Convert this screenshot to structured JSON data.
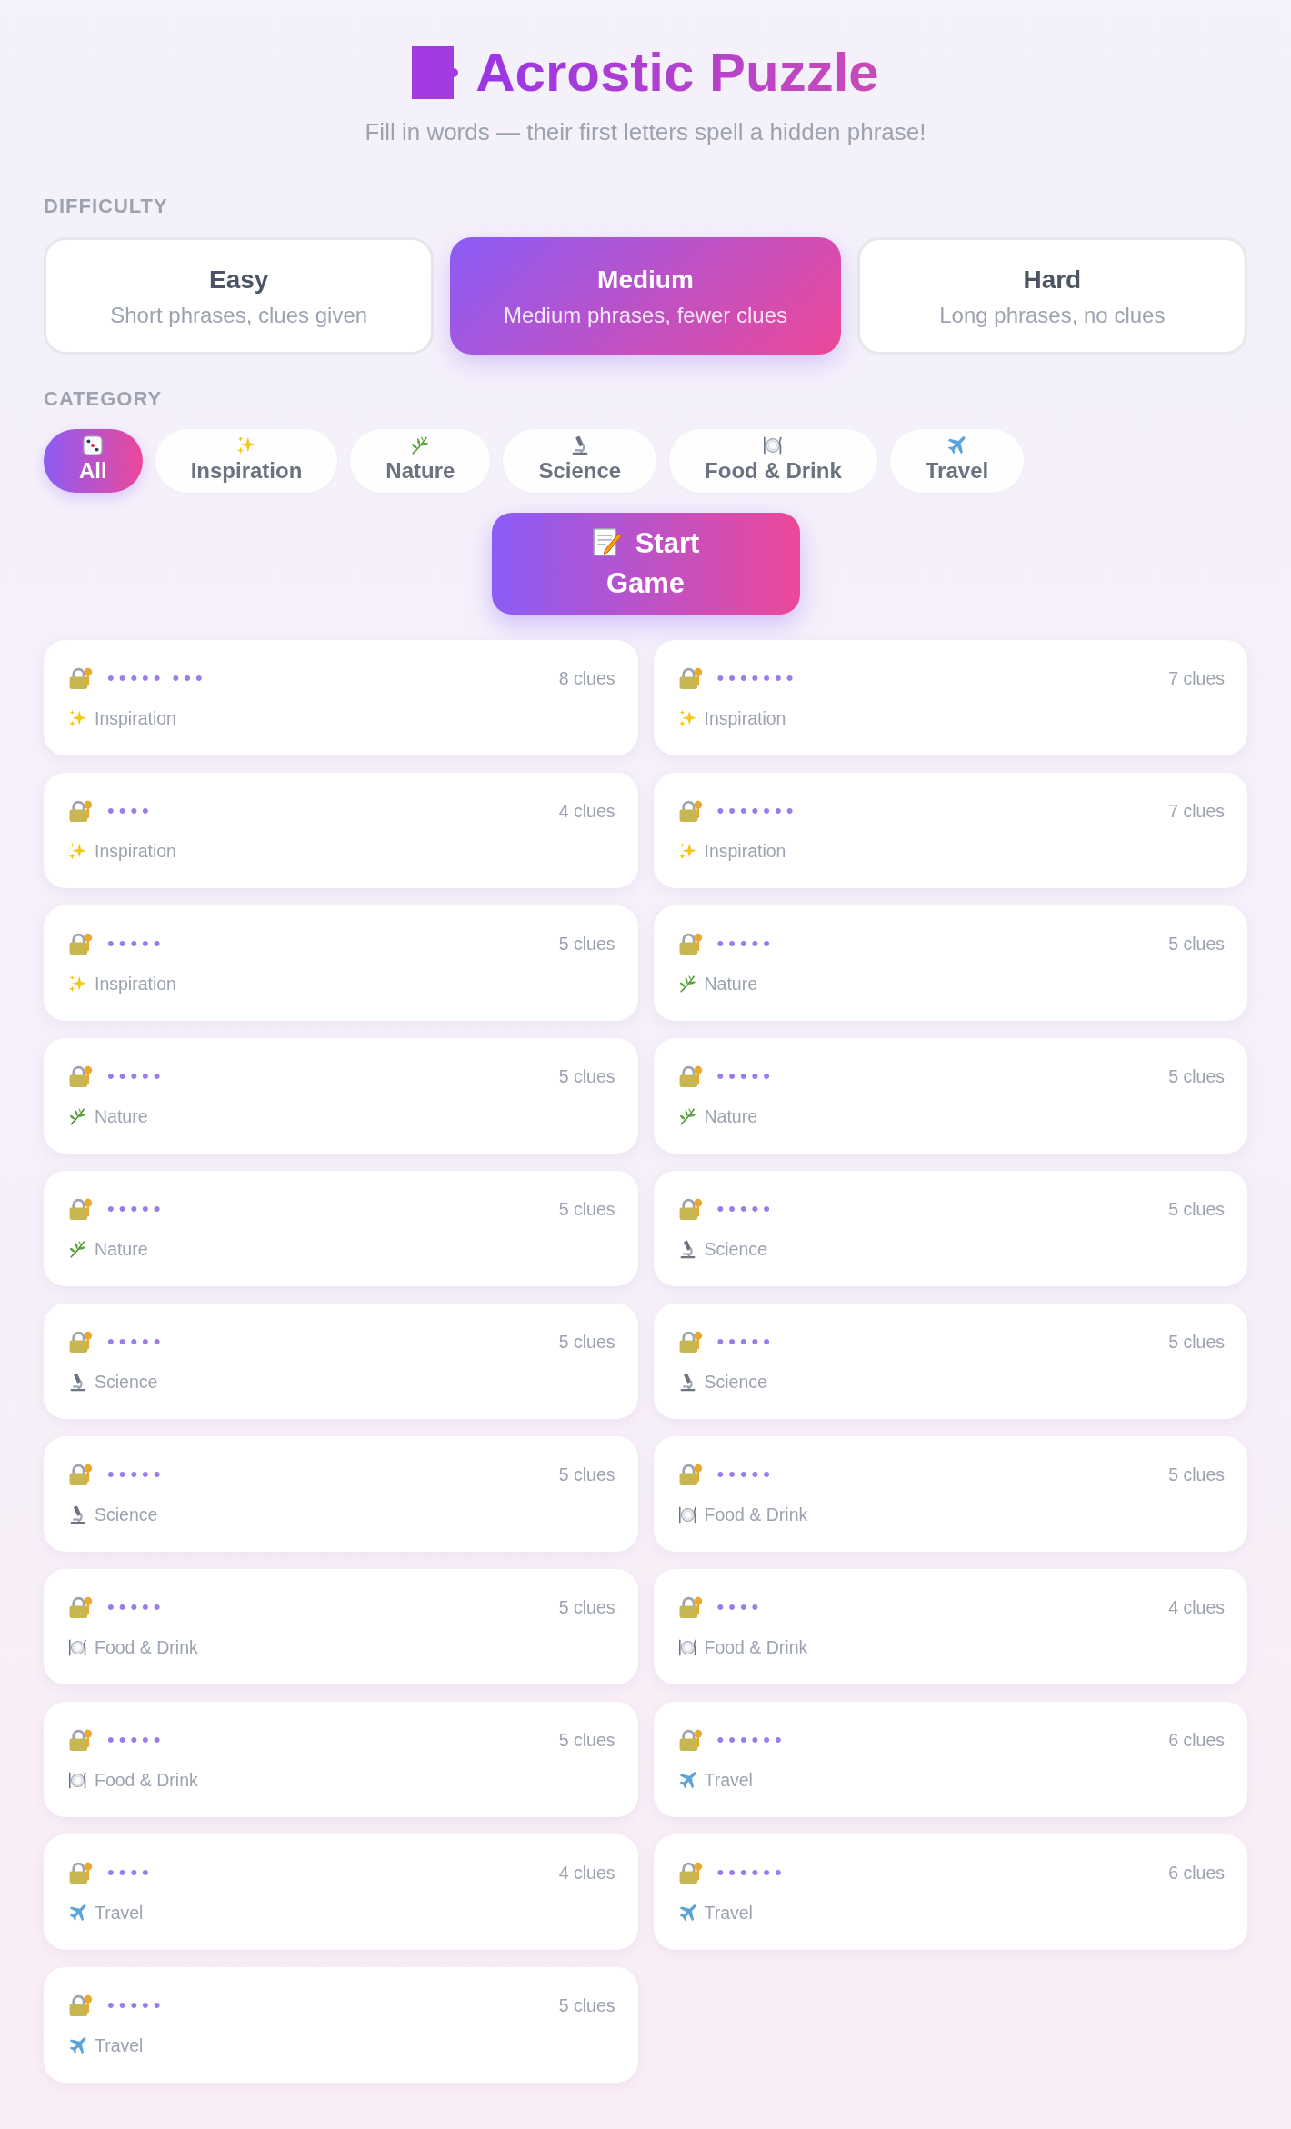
{
  "header": {
    "title": "Acrostic Puzzle",
    "subtitle": "Fill in words — their first letters spell a hidden phrase!"
  },
  "difficulty": {
    "label": "DIFFICULTY",
    "options": [
      {
        "label": "Easy",
        "description": "Short phrases, clues given",
        "selected": false
      },
      {
        "label": "Medium",
        "description": "Medium phrases, fewer clues",
        "selected": true
      },
      {
        "label": "Hard",
        "description": "Long phrases, no clues",
        "selected": false
      }
    ]
  },
  "category": {
    "label": "CATEGORY",
    "options": [
      {
        "label": "All",
        "kind": "dice",
        "selected": true
      },
      {
        "label": "Inspiration",
        "kind": "sparkles",
        "selected": false
      },
      {
        "label": "Nature",
        "kind": "leaf",
        "selected": false
      },
      {
        "label": "Science",
        "kind": "microscope",
        "selected": false
      },
      {
        "label": "Food & Drink",
        "kind": "plate",
        "selected": false
      },
      {
        "label": "Travel",
        "kind": "plane",
        "selected": false
      }
    ]
  },
  "start_button": {
    "label": "Start Game"
  },
  "puzzles": [
    {
      "locked": true,
      "mask": "••••• •••",
      "clues": "8 clues",
      "category": "Inspiration",
      "kind": "sparkles"
    },
    {
      "locked": true,
      "mask": "•••••••",
      "clues": "7 clues",
      "category": "Inspiration",
      "kind": "sparkles"
    },
    {
      "locked": true,
      "mask": "••••",
      "clues": "4 clues",
      "category": "Inspiration",
      "kind": "sparkles"
    },
    {
      "locked": true,
      "mask": "•••••••",
      "clues": "7 clues",
      "category": "Inspiration",
      "kind": "sparkles"
    },
    {
      "locked": true,
      "mask": "•••••",
      "clues": "5 clues",
      "category": "Inspiration",
      "kind": "sparkles"
    },
    {
      "locked": true,
      "mask": "•••••",
      "clues": "5 clues",
      "category": "Nature",
      "kind": "leaf"
    },
    {
      "locked": true,
      "mask": "•••••",
      "clues": "5 clues",
      "category": "Nature",
      "kind": "leaf"
    },
    {
      "locked": true,
      "mask": "•••••",
      "clues": "5 clues",
      "category": "Nature",
      "kind": "leaf"
    },
    {
      "locked": true,
      "mask": "•••••",
      "clues": "5 clues",
      "category": "Nature",
      "kind": "leaf"
    },
    {
      "locked": true,
      "mask": "•••••",
      "clues": "5 clues",
      "category": "Science",
      "kind": "microscope"
    },
    {
      "locked": true,
      "mask": "•••••",
      "clues": "5 clues",
      "category": "Science",
      "kind": "microscope"
    },
    {
      "locked": true,
      "mask": "•••••",
      "clues": "5 clues",
      "category": "Science",
      "kind": "microscope"
    },
    {
      "locked": true,
      "mask": "•••••",
      "clues": "5 clues",
      "category": "Science",
      "kind": "microscope"
    },
    {
      "locked": true,
      "mask": "•••••",
      "clues": "5 clues",
      "category": "Food & Drink",
      "kind": "plate"
    },
    {
      "locked": true,
      "mask": "•••••",
      "clues": "5 clues",
      "category": "Food & Drink",
      "kind": "plate"
    },
    {
      "locked": true,
      "mask": "••••",
      "clues": "4 clues",
      "category": "Food & Drink",
      "kind": "plate"
    },
    {
      "locked": true,
      "mask": "•••••",
      "clues": "5 clues",
      "category": "Food & Drink",
      "kind": "plate"
    },
    {
      "locked": true,
      "mask": "••••••",
      "clues": "6 clues",
      "category": "Travel",
      "kind": "plane"
    },
    {
      "locked": true,
      "mask": "••••",
      "clues": "4 clues",
      "category": "Travel",
      "kind": "plane"
    },
    {
      "locked": true,
      "mask": "••••••",
      "clues": "6 clues",
      "category": "Travel",
      "kind": "plane"
    },
    {
      "locked": true,
      "mask": "•••••",
      "clues": "5 clues",
      "category": "Travel",
      "kind": "plane"
    }
  ]
}
